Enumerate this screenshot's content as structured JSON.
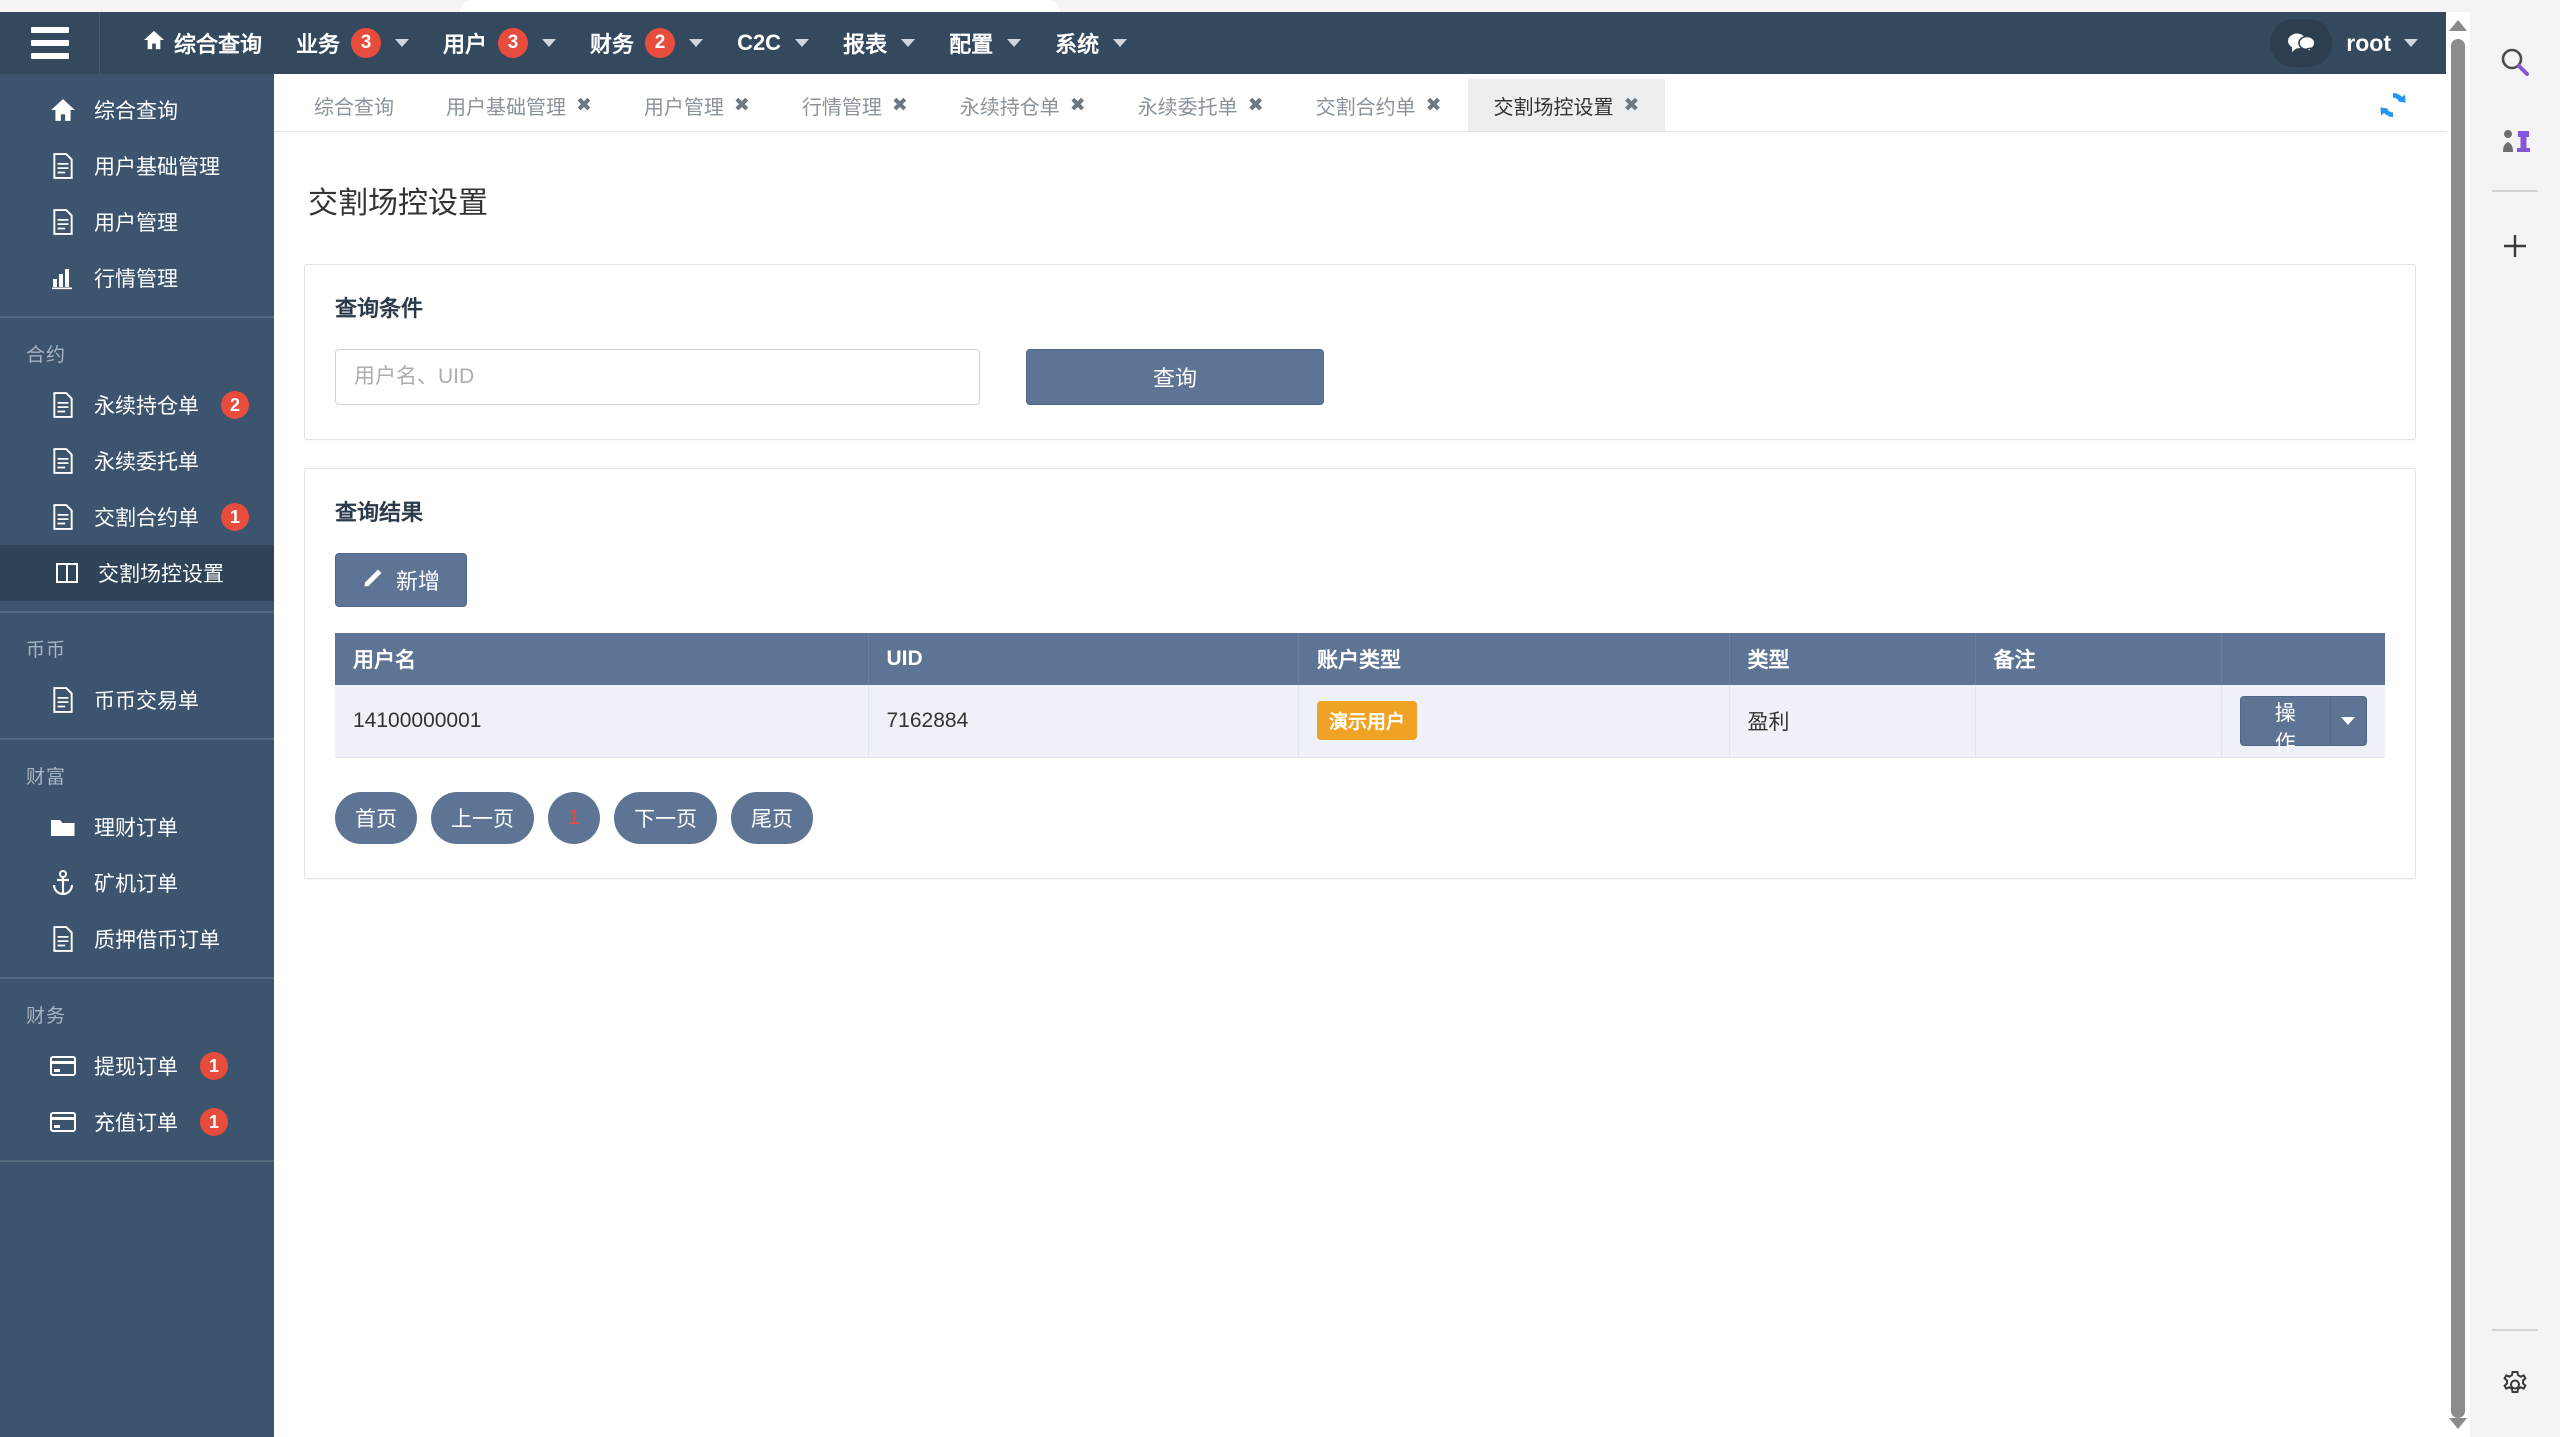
{
  "colors": {
    "navbar_bg": "#34495e",
    "sidebar_bg": "#3c546d",
    "sidebar_active_bg": "#2f4458",
    "accent_blue": "#5d7494",
    "badge_red": "#e74c3c",
    "badge_orange": "#f0a225",
    "table_row_bg": "#eef1f7",
    "refresh_blue": "#2196f3",
    "current_page_red": "#e74c3c"
  },
  "navbar": {
    "menu_toggle_icon": "hamburger-icon",
    "items": [
      {
        "label": "综合查询",
        "icon": "home-icon",
        "badge": null,
        "caret": false
      },
      {
        "label": "业务",
        "icon": null,
        "badge": "3",
        "caret": true
      },
      {
        "label": "用户",
        "icon": null,
        "badge": "3",
        "caret": true
      },
      {
        "label": "财务",
        "icon": null,
        "badge": "2",
        "caret": true
      },
      {
        "label": "C2C",
        "icon": null,
        "badge": null,
        "caret": true
      },
      {
        "label": "报表",
        "icon": null,
        "badge": null,
        "caret": true
      },
      {
        "label": "配置",
        "icon": null,
        "badge": null,
        "caret": true
      },
      {
        "label": "系统",
        "icon": null,
        "badge": null,
        "caret": true
      }
    ],
    "chat_icon": "chat-bubbles-icon",
    "user": "root"
  },
  "sidebar": {
    "groups": [
      {
        "heading": null,
        "items": [
          {
            "label": "综合查询",
            "icon": "home-icon",
            "badge": null,
            "active": false
          },
          {
            "label": "用户基础管理",
            "icon": "document-icon",
            "badge": null,
            "active": false
          },
          {
            "label": "用户管理",
            "icon": "document-icon",
            "badge": null,
            "active": false
          },
          {
            "label": "行情管理",
            "icon": "bar-chart-icon",
            "badge": null,
            "active": false
          }
        ]
      },
      {
        "heading": "合约",
        "items": [
          {
            "label": "永续持仓单",
            "icon": "document-icon",
            "badge": "2",
            "active": false
          },
          {
            "label": "永续委托单",
            "icon": "document-icon",
            "badge": null,
            "active": false
          },
          {
            "label": "交割合约单",
            "icon": "document-icon",
            "badge": "1",
            "active": false
          },
          {
            "label": "交割场控设置",
            "icon": "columns-icon",
            "badge": null,
            "active": true
          }
        ]
      },
      {
        "heading": "币币",
        "items": [
          {
            "label": "币币交易单",
            "icon": "document-icon",
            "badge": null,
            "active": false
          }
        ]
      },
      {
        "heading": "财富",
        "items": [
          {
            "label": "理财订单",
            "icon": "folder-icon",
            "badge": null,
            "active": false
          },
          {
            "label": "矿机订单",
            "icon": "anchor-icon",
            "badge": null,
            "active": false
          },
          {
            "label": "质押借币订单",
            "icon": "document-icon",
            "badge": null,
            "active": false
          }
        ]
      },
      {
        "heading": "财务",
        "items": [
          {
            "label": "提现订单",
            "icon": "credit-card-icon",
            "badge": "1",
            "active": false
          },
          {
            "label": "充值订单",
            "icon": "credit-card-icon",
            "badge": "1",
            "active": false
          }
        ]
      }
    ]
  },
  "tabs": [
    {
      "label": "综合查询",
      "closable": false,
      "active": false
    },
    {
      "label": "用户基础管理",
      "closable": true,
      "active": false
    },
    {
      "label": "用户管理",
      "closable": true,
      "active": false
    },
    {
      "label": "行情管理",
      "closable": true,
      "active": false
    },
    {
      "label": "永续持仓单",
      "closable": true,
      "active": false
    },
    {
      "label": "永续委托单",
      "closable": true,
      "active": false
    },
    {
      "label": "交割合约单",
      "closable": true,
      "active": false
    },
    {
      "label": "交割场控设置",
      "closable": true,
      "active": true
    }
  ],
  "tab_refresh_icon": "refresh-icon",
  "page": {
    "title": "交割场控设置"
  },
  "query_panel": {
    "title": "查询条件",
    "search_placeholder": "用户名、UID",
    "search_value": "",
    "submit_label": "查询"
  },
  "results_panel": {
    "title": "查询结果",
    "add_label": "新增",
    "add_icon": "pencil-icon",
    "columns": [
      "用户名",
      "UID",
      "账户类型",
      "类型",
      "备注",
      ""
    ],
    "rows": [
      {
        "用户名": "14100000001",
        "UID": "7162884",
        "账户类型": "演示用户",
        "类型": "盈利",
        "备注": "",
        "action_label": "操作",
        "action_caret_icon": "chevron-down-icon"
      }
    ],
    "pagination": {
      "first": "首页",
      "prev": "上一页",
      "current": "1",
      "next": "下一页",
      "last": "尾页"
    }
  },
  "right_rail": {
    "items": [
      {
        "icon": "search-icon"
      },
      {
        "icon": "chess-pieces-icon"
      },
      {
        "icon": "plus-icon"
      }
    ],
    "bottom": {
      "icon": "gear-icon"
    }
  },
  "scrollbar": {
    "up_arrow_icon": "triangle-up-icon",
    "down_arrow_icon": "triangle-down-icon"
  }
}
